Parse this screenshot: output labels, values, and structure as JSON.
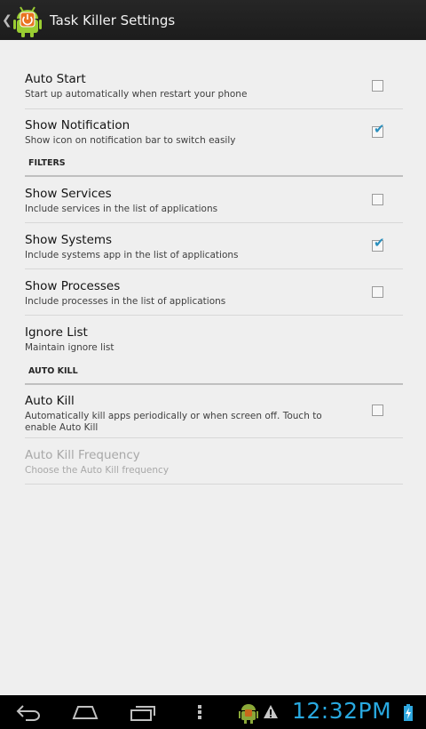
{
  "actionbar": {
    "title": "Task Killer Settings",
    "icon": "android-power-icon"
  },
  "preferences": [
    {
      "type": "checkbox",
      "title": "Auto Start",
      "summary": "Start up automatically when restart your phone",
      "checked": false,
      "enabled": true
    },
    {
      "type": "checkbox",
      "title": "Show Notification",
      "summary": "Show icon on notification bar to switch easily",
      "checked": true,
      "enabled": true
    },
    {
      "type": "category",
      "title": "FILTERS"
    },
    {
      "type": "checkbox",
      "title": "Show Services",
      "summary": "Include services in the list of applications",
      "checked": false,
      "enabled": true
    },
    {
      "type": "checkbox",
      "title": "Show Systems",
      "summary": "Include systems app in the list of applications",
      "checked": true,
      "enabled": true
    },
    {
      "type": "checkbox",
      "title": "Show Processes",
      "summary": "Include processes in the list of applications",
      "checked": false,
      "enabled": true
    },
    {
      "type": "item",
      "title": "Ignore List",
      "summary": "Maintain ignore list",
      "enabled": true
    },
    {
      "type": "category",
      "title": "AUTO KILL"
    },
    {
      "type": "checkbox",
      "title": "Auto Kill",
      "summary": "Automatically kill apps periodically or when screen off. Touch to enable Auto Kill",
      "checked": false,
      "enabled": true
    },
    {
      "type": "item",
      "title": "Auto Kill Frequency",
      "summary": "Choose the Auto Kill frequency",
      "enabled": false
    }
  ],
  "navbar": {
    "buttons": [
      "back-icon",
      "home-icon",
      "recent-apps-icon",
      "menu-overflow-icon"
    ],
    "status_icons": [
      "android-notification-icon",
      "warning-icon",
      "battery-charging-icon"
    ],
    "clock": "12:32PM"
  },
  "colors": {
    "actionbar_bg": "#1f1f1f",
    "content_bg": "#efefef",
    "check_accent": "#2a8fbd",
    "clock": "#29a9e0"
  }
}
